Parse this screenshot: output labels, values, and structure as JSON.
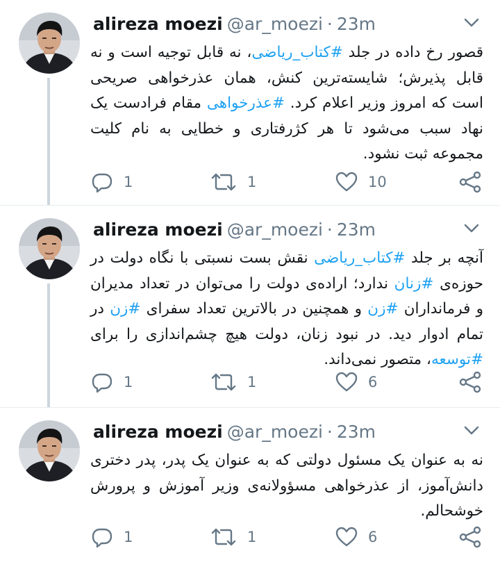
{
  "tweets": [
    {
      "author": {
        "name": "alireza moezi",
        "handle": "@ar_moezi",
        "time": "23m"
      },
      "segments": [
        {
          "text": "قصور رخ داده در جلد ",
          "tag": false
        },
        {
          "text": "#کتاب_ریاضی",
          "tag": true
        },
        {
          "text": "، نه قابل توجیه است و نه قابل پذیرش؛ شایسته‌ترین کنش، همان عذرخواهی صریحی است که امروز وزیر اعلام کرد. ",
          "tag": false
        },
        {
          "text": "#عذرخواهی",
          "tag": true
        },
        {
          "text": " مقام فرادست یک نهاد سبب می‌شود تا هر کژرفتاری و خطایی به نام کلیت مجموعه ثبت نشود.",
          "tag": false
        }
      ],
      "replies": "1",
      "retweets": "1",
      "likes": "10"
    },
    {
      "author": {
        "name": "alireza moezi",
        "handle": "@ar_moezi",
        "time": "23m"
      },
      "segments": [
        {
          "text": "آنچه بر جلد ",
          "tag": false
        },
        {
          "text": "#کتاب_ریاضی",
          "tag": true
        },
        {
          "text": " نقش بست نسبتی با نگاه دولت در حوزه‌ی ",
          "tag": false
        },
        {
          "text": "#زنان",
          "tag": true
        },
        {
          "text": " ندارد؛ اراده‌ی دولت را می‌توان در تعداد مدیران و فرمانداران ",
          "tag": false
        },
        {
          "text": "#زن",
          "tag": true
        },
        {
          "text": " و همچنین در بالاترین تعداد سفرای ",
          "tag": false
        },
        {
          "text": "#زن",
          "tag": true
        },
        {
          "text": " در تمام ادوار دید. در نبود زنان، دولت هیچ چشم‌اندازی را برای ",
          "tag": false
        },
        {
          "text": "#توسعه",
          "tag": true
        },
        {
          "text": "، متصور نمی‌داند.",
          "tag": false
        }
      ],
      "replies": "1",
      "retweets": "1",
      "likes": "6"
    },
    {
      "author": {
        "name": "alireza moezi",
        "handle": "@ar_moezi",
        "time": "23m"
      },
      "segments": [
        {
          "text": "نه به عنوان یک مسئول دولتی که به عنوان یک پدر، پدر دختری دانش‌آموز، از عذرخواهی مسؤولانه‌ی وزیر آموزش و پرورش خوشحالم.",
          "tag": false
        }
      ],
      "replies": "1",
      "retweets": "1",
      "likes": "6"
    }
  ],
  "icons": {
    "reply": "reply-icon",
    "retweet": "retweet-icon",
    "like": "heart-icon",
    "share": "share-icon",
    "menu": "chevron-down-icon"
  },
  "colors": {
    "text": "#14171a",
    "secondary": "#657786",
    "hashtag": "#1da1f2",
    "thread_line": "#ccd6dd"
  }
}
